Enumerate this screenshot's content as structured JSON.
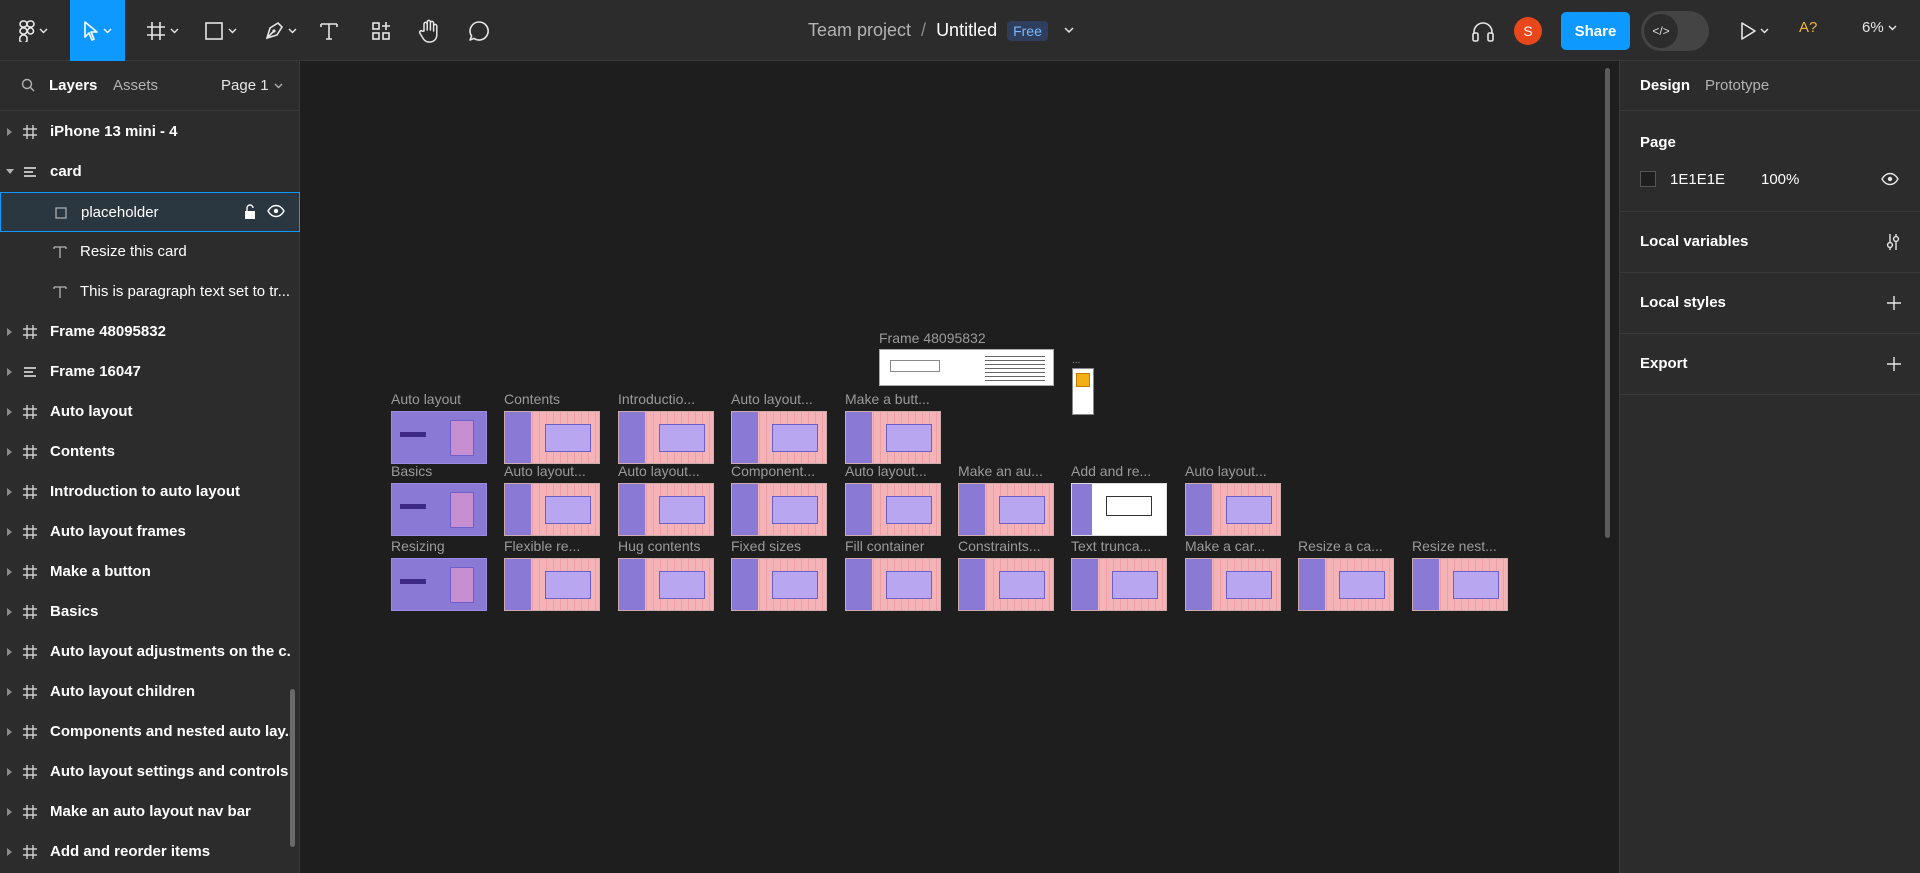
{
  "toolbar": {
    "title_team": "Team project",
    "title_sep": "/",
    "title_file": "Untitled",
    "badge": "Free",
    "avatar_letter": "S",
    "share_label": "Share",
    "dev_mode_label": "</>",
    "font_warning": "A?",
    "zoom": "6%"
  },
  "left_panel": {
    "tab_layers": "Layers",
    "tab_assets": "Assets",
    "page_selector": "Page 1",
    "layers": [
      {
        "label": "iPhone 13 mini - 4"
      },
      {
        "label": "card"
      },
      {
        "label": "placeholder"
      },
      {
        "label": "Resize this card"
      },
      {
        "label": "This is paragraph text set to tr..."
      },
      {
        "label": "Frame 48095832"
      },
      {
        "label": "Frame 16047"
      },
      {
        "label": "Auto layout"
      },
      {
        "label": "Contents"
      },
      {
        "label": "Introduction to auto layout"
      },
      {
        "label": "Auto layout frames"
      },
      {
        "label": "Make a button"
      },
      {
        "label": "Basics"
      },
      {
        "label": "Auto layout adjustments on the c..."
      },
      {
        "label": "Auto layout children"
      },
      {
        "label": "Components and nested auto lay..."
      },
      {
        "label": "Auto layout settings and controls"
      },
      {
        "label": "Make an auto layout nav bar"
      },
      {
        "label": "Add and  reorder items"
      }
    ]
  },
  "canvas": {
    "frame48_label": "Frame 48095832",
    "ycard_dots": "...",
    "row1": [
      "Auto layout",
      "Contents",
      "Introductio...",
      "Auto layout...",
      "Make a butt..."
    ],
    "row2": [
      "Basics",
      "Auto layout...",
      "Auto layout...",
      "Component...",
      "Auto layout...",
      "Make an au...",
      "Add and  re...",
      "Auto layout..."
    ],
    "row3": [
      "Resizing",
      "Flexible re...",
      "Hug contents",
      "Fixed sizes",
      "Fill container",
      "Constraints...",
      "Text trunca...",
      "Make a car...",
      "Resize a ca...",
      "Resize nest..."
    ],
    "help": "?"
  },
  "right_panel": {
    "tab_design": "Design",
    "tab_prototype": "Prototype",
    "page_title": "Page",
    "bg_hex": "1E1E1E",
    "bg_opacity": "100%",
    "local_variables": "Local variables",
    "local_styles": "Local styles",
    "export": "Export"
  },
  "colors": {
    "accent": "#0d99ff",
    "canvas_bg": "#1e1e1e",
    "panel_bg": "#2c2c2c",
    "avatar": "#e8471b"
  }
}
